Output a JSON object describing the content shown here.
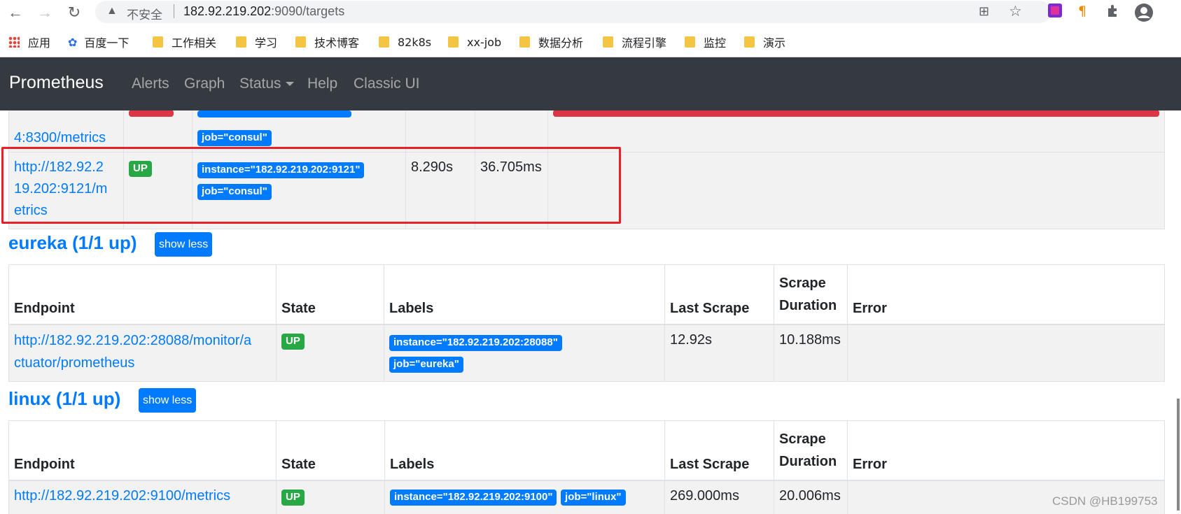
{
  "browser": {
    "back_icon": "←",
    "forward_icon": "→",
    "reload_icon": "↻",
    "warning_icon": "▲",
    "insecure_label": "不安全",
    "url_host": "182.92.219.202",
    "url_rest": ":9090/targets",
    "translate_icon": "⊞",
    "star_icon": "☆"
  },
  "bookmarks": [
    {
      "label": "应用",
      "icon": "apps-icon"
    },
    {
      "label": "百度一下",
      "icon": "baidu-icon"
    },
    {
      "label": "工作相关",
      "icon": "folder-icon"
    },
    {
      "label": "学习",
      "icon": "folder-icon"
    },
    {
      "label": "技术博客",
      "icon": "folder-icon"
    },
    {
      "label": "82k8s",
      "icon": "folder-icon"
    },
    {
      "label": "xx-job",
      "icon": "folder-icon"
    },
    {
      "label": "数据分析",
      "icon": "folder-icon"
    },
    {
      "label": "流程引擎",
      "icon": "folder-icon"
    },
    {
      "label": "监控",
      "icon": "folder-icon"
    },
    {
      "label": "演示",
      "icon": "folder-icon"
    }
  ],
  "navbar": {
    "brand": "Prometheus",
    "items": [
      "Alerts",
      "Graph",
      "Status",
      "Help",
      "Classic UI"
    ]
  },
  "consul_partial": {
    "endpoint_tail": "4:8300/metrics",
    "label_job": "job=\"consul\"",
    "row2": {
      "endpoint": "http://182.92.219.202:9121/metrics",
      "endpoint_lines": [
        "http://182.92.2",
        "19.202:9121/m",
        "etrics"
      ],
      "state": "UP",
      "label_instance": "instance=\"182.92.219.202:9121\"",
      "label_job": "job=\"consul\"",
      "last_scrape": "8.290s",
      "scrape_duration": "36.705ms",
      "error": ""
    }
  },
  "headers": {
    "endpoint": "Endpoint",
    "state": "State",
    "labels": "Labels",
    "last_scrape": "Last Scrape",
    "scrape_duration_1": "Scrape",
    "scrape_duration_2": "Duration",
    "error": "Error"
  },
  "eureka": {
    "title": "eureka (1/1 up)",
    "button": "show less",
    "row": {
      "endpoint_line1": "http://182.92.219.202:28088/monitor/a",
      "endpoint_line2": "ctuator/prometheus",
      "state": "UP",
      "label_instance": "instance=\"182.92.219.202:28088\"",
      "label_job": "job=\"eureka\"",
      "last_scrape": "12.92s",
      "scrape_duration": "10.188ms",
      "error": ""
    }
  },
  "linux": {
    "title": "linux (1/1 up)",
    "button": "show less",
    "row": {
      "endpoint": "http://182.92.219.202:9100/metrics",
      "state": "UP",
      "label_instance": "instance=\"182.92.219.202:9100\"",
      "label_job": "job=\"linux\"",
      "last_scrape": "269.000ms",
      "scrape_duration": "20.006ms",
      "error": ""
    }
  },
  "watermark": "CSDN @HB199753"
}
